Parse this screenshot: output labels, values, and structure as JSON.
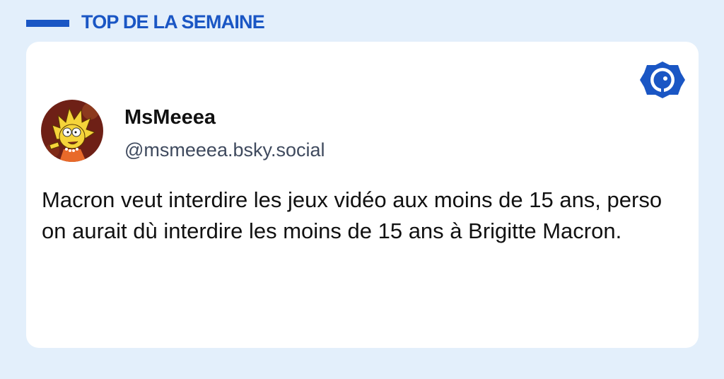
{
  "header": {
    "title": "TOP DE LA SEMAINE"
  },
  "post": {
    "author_name": "MsMeeea",
    "author_handle": "@msmeeea.bsky.social",
    "text": "Macron veut interdire les jeux vidéo aux moins de 15 ans, perso on aurait dù interdire les moins de 15 ans à Brigitte Macron."
  },
  "icons": {
    "brand_logo": "bluesky-app-icon",
    "avatar": "cartoon-character-avatar"
  },
  "colors": {
    "page_background": "#e3effb",
    "accent": "#1a56c4",
    "card_background": "#ffffff",
    "handle_text": "#3f4a5e"
  }
}
